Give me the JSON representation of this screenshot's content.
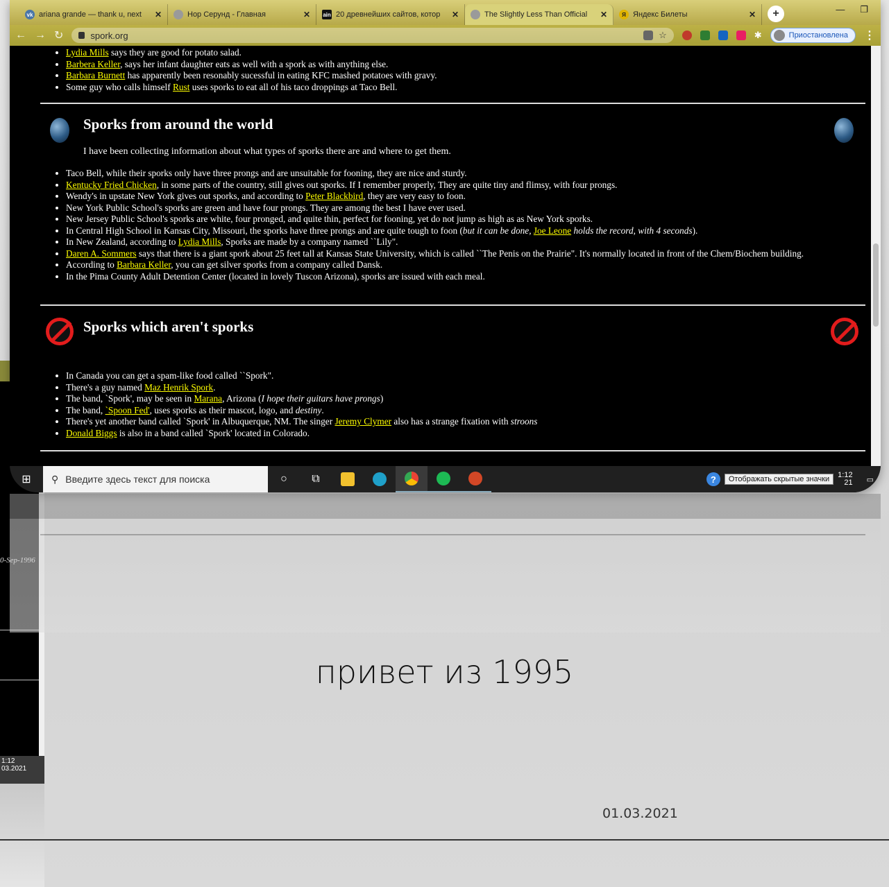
{
  "browser": {
    "tabs": [
      {
        "title": "ariana grande — thank u, next",
        "color": "#4a76a8",
        "glyph": "vk"
      },
      {
        "title": "Нор Серунд - Главная",
        "color": "#9a9a9a",
        "glyph": ""
      },
      {
        "title": "20 древнейших сайтов, котор",
        "color": "#111111",
        "glyph": "ain"
      },
      {
        "title": "The Slightly Less Than Official",
        "color": "#9a9a9a",
        "glyph": ""
      },
      {
        "title": "Яндекс Билеты",
        "color": "#e0b400",
        "glyph": "Я"
      }
    ],
    "url": "spork.org",
    "profile_status": "Приостановлена"
  },
  "page": {
    "testimonials": [
      {
        "link": "Lydia Mills",
        "text": " says they are good for potato salad."
      },
      {
        "link": "Barbera Keller",
        "text": ", says her infant daughter eats as well with a spork as with anything else."
      },
      {
        "link": "Barbara Burnett",
        "text": " has apparently been resonably sucessful in eating KFC mashed potatoes with gravy."
      },
      {
        "pre": "Some guy who calls himself ",
        "link": "Rust",
        "text": " uses sporks to eat all of his taco droppings at Taco Bell."
      }
    ],
    "world": {
      "title": "Sporks from around the world",
      "intro": "I have been collecting information about what types of sporks there are and where to get them.",
      "items": [
        {
          "pre": "Taco Bell, while their sporks only have three prongs and are unsuitable for fooning, they are nice and sturdy.",
          "link": "",
          "text": ""
        },
        {
          "pre": "",
          "link": "Kentucky Fried Chicken",
          "text": ", in some parts of the country, still gives out sporks. If I remember properly, They are quite tiny and flimsy, with four prongs."
        },
        {
          "pre": "Wendy's in upstate New York gives out sporks, and according to ",
          "link": "Peter Blackbird",
          "text": ", they are very easy to foon."
        },
        {
          "pre": "New York Public School's sporks are green and have four prongs. They are among the best I have ever used.",
          "link": "",
          "text": ""
        },
        {
          "pre": "New Jersey Public School's sporks are white, four pronged, and quite thin, perfect for fooning, yet do not jump as high as as New York sporks.",
          "link": "",
          "text": ""
        },
        {
          "pre": "In Central High School in Kansas City, Missouri, the sporks have three prongs and are quite tough to foon (",
          "em1": "but it can be done, ",
          "link": "Joe Leone",
          "em2": " holds the record, with 4 seconds",
          "text": ")."
        },
        {
          "pre": "In New Zealand, according to ",
          "link": "Lydia Mills",
          "text": ", Sporks are made by a company named ``Lily\"."
        },
        {
          "pre": "",
          "link": "Daren A. Sommers",
          "text": " says that there is a giant spork about 25 feet tall at Kansas State University, which is called ``The Penis on the Prairie\". It's normally located in front of the Chem/Biochem building."
        },
        {
          "pre": "According to ",
          "link": "Barbara Keller",
          "text": ", you can get silver sporks from a company called Dansk."
        },
        {
          "pre": "In the Pima County Adult Detention Center (located in lovely Tuscon Arizona), sporks are issued with each meal.",
          "link": "",
          "text": ""
        }
      ]
    },
    "notsporks": {
      "title": "Sporks which aren't sporks",
      "items": [
        {
          "pre": "In Canada you can get a spam-like food called ``Spork\".",
          "link": "",
          "text": ""
        },
        {
          "pre": "There's a guy named ",
          "link": "Maz Henrik Spork",
          "text": "."
        },
        {
          "pre": "The band, `Spork', may be seen in ",
          "link": "Marana",
          "text": ", Arizona (",
          "em2": "I hope their guitars have prongs",
          "tail": ")"
        },
        {
          "pre": "The band, ",
          "link": "`Spoon Fed'",
          "text": ", uses sporks as their mascot, logo, and ",
          "em2": "destiny",
          "tail": "."
        },
        {
          "pre": "There's yet another band called `Spork' in Albuquerque, NM. The singer ",
          "link": "Jeremy Clymer",
          "text": " also has a strange fixation with ",
          "em2": "stroons",
          "tail": ""
        },
        {
          "pre": "",
          "link": "Donald Biggs",
          "text": " is also in a band called `Spork' located in Colorado."
        }
      ]
    }
  },
  "taskbar": {
    "search_placeholder": "Введите здесь текст для поиска",
    "tooltip": "Отображать скрытые значки",
    "time": "1:12",
    "date_partial": "21"
  },
  "back_slide": {
    "date": "0-Sep-1996",
    "time": "1:12",
    "date_short": "03.2021"
  },
  "slide": {
    "caption": "привет из 1995",
    "date": "01.03.2021"
  }
}
